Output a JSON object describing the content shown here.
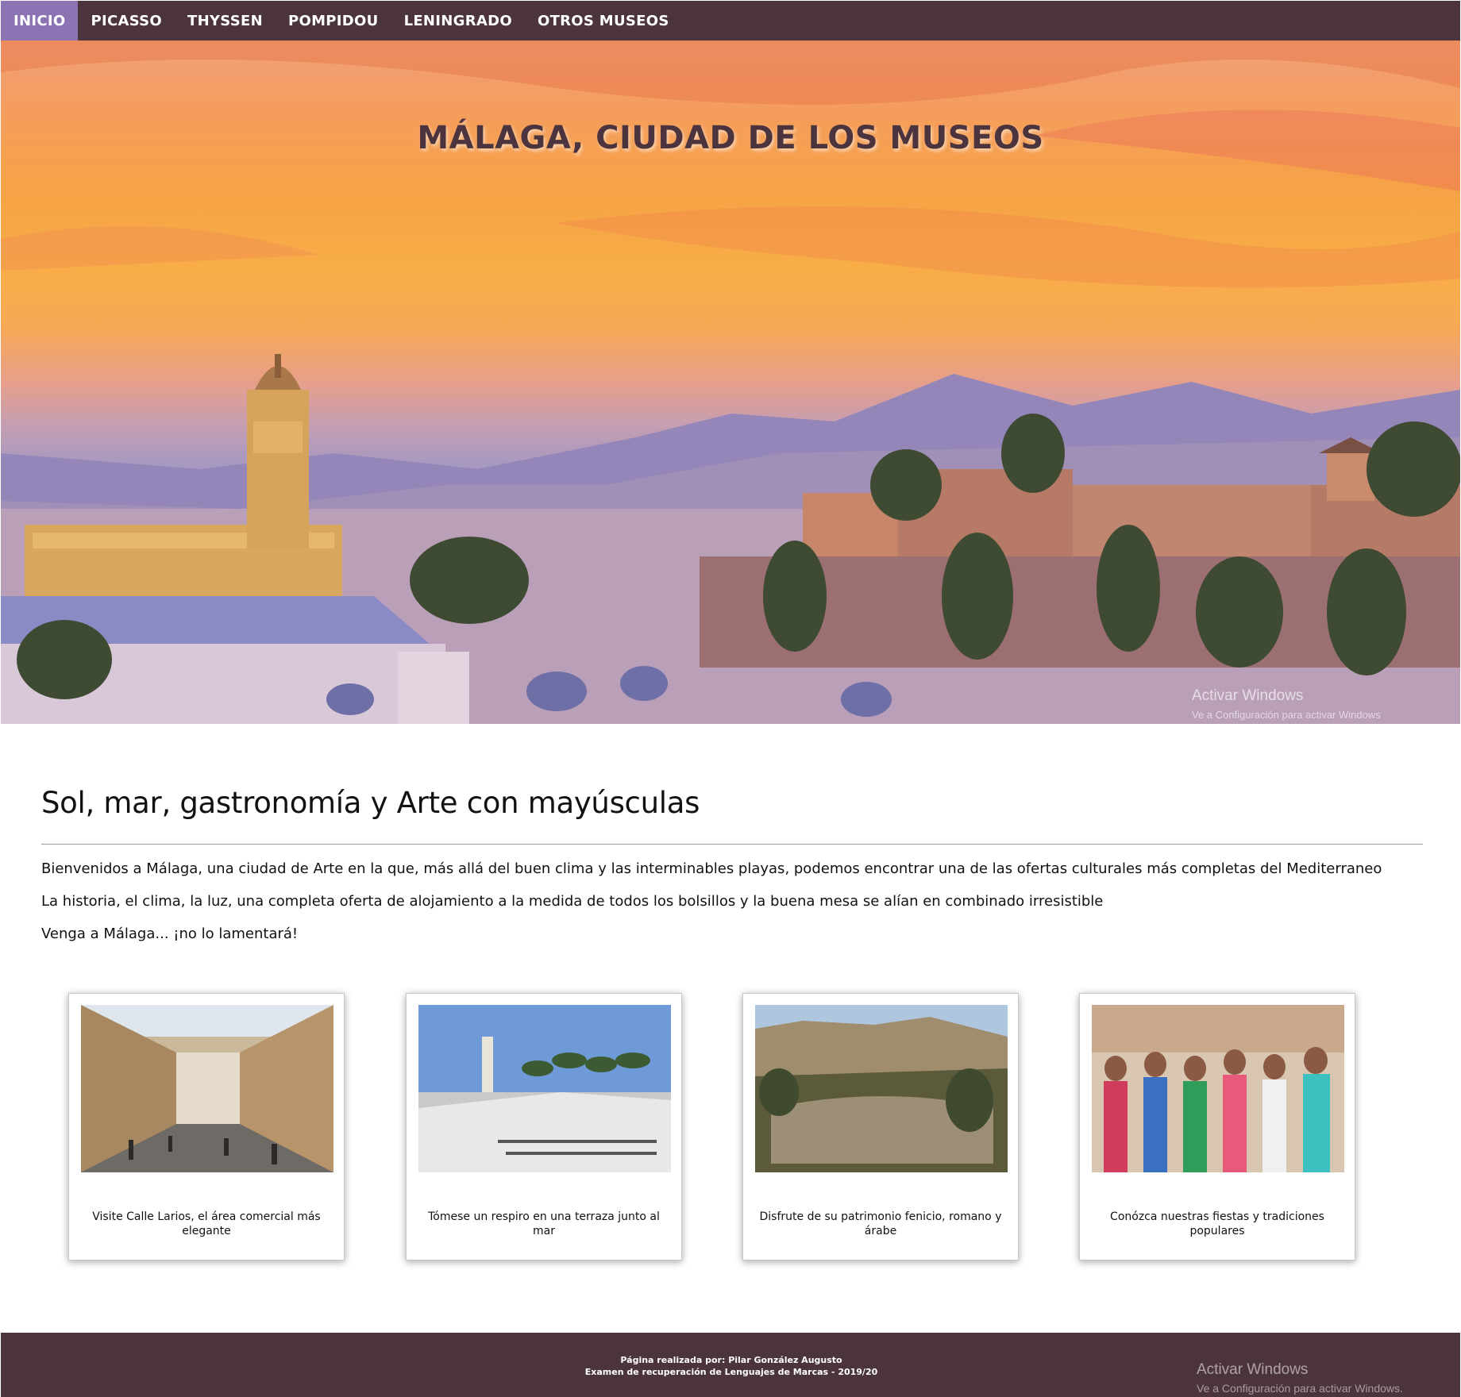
{
  "nav": {
    "items": [
      {
        "label": "INICIO",
        "active": true
      },
      {
        "label": "PICASSO"
      },
      {
        "label": "THYSSEN"
      },
      {
        "label": "POMPIDOU"
      },
      {
        "label": "LENINGRADO"
      },
      {
        "label": "OTROS MUSEOS"
      }
    ]
  },
  "hero": {
    "title": "MÁLAGA, CIUDAD DE LOS MUSEOS",
    "image": "malaga-skyline-sunset-cathedral-alcazaba"
  },
  "intro": {
    "heading": "Sol, mar, gastronomía y Arte con mayúsculas",
    "paragraphs": [
      "Bienvenidos a Málaga, una ciudad de Arte en la que, más allá del buen clima y las interminables playas, podemos encontrar una de las ofertas culturales más completas del Mediterraneo",
      "La historia, el clima, la luz, una completa oferta de alojamiento a la medida de todos los bolsillos y la buena mesa se alían en combinado irresistible",
      "Venga a Málaga... ¡no lo lamentará!"
    ]
  },
  "cards": [
    {
      "caption": "Visite Calle Larios, el área comercial más elegante",
      "image": "calle-larios-street"
    },
    {
      "caption": "Tómese un respiro en una terraza junto al mar",
      "image": "seaside-terrace-palms"
    },
    {
      "caption": "Disfrute de su patrimonio fenicio, romano y árabe",
      "image": "roman-theatre-alcazaba"
    },
    {
      "caption": "Conózca nuestras fiestas y tradiciones populares",
      "image": "feria-flamenco-dresses"
    }
  ],
  "footer": {
    "line1": "Página realizada por: Pilar González Augusto",
    "line2": "Examen de recuperación de Lenguajes de Marcas - 2019/20"
  },
  "watermark": {
    "title": "Activar Windows",
    "subtitle_hero": "Ve a Configuración para activar Windows",
    "subtitle_footer": "Ve a Configuración para activar Windows."
  },
  "colors": {
    "nav_bg": "#4b343d",
    "nav_active": "#8b73b4",
    "footer_bg": "#4b343d",
    "title_color": "#4b343d"
  }
}
